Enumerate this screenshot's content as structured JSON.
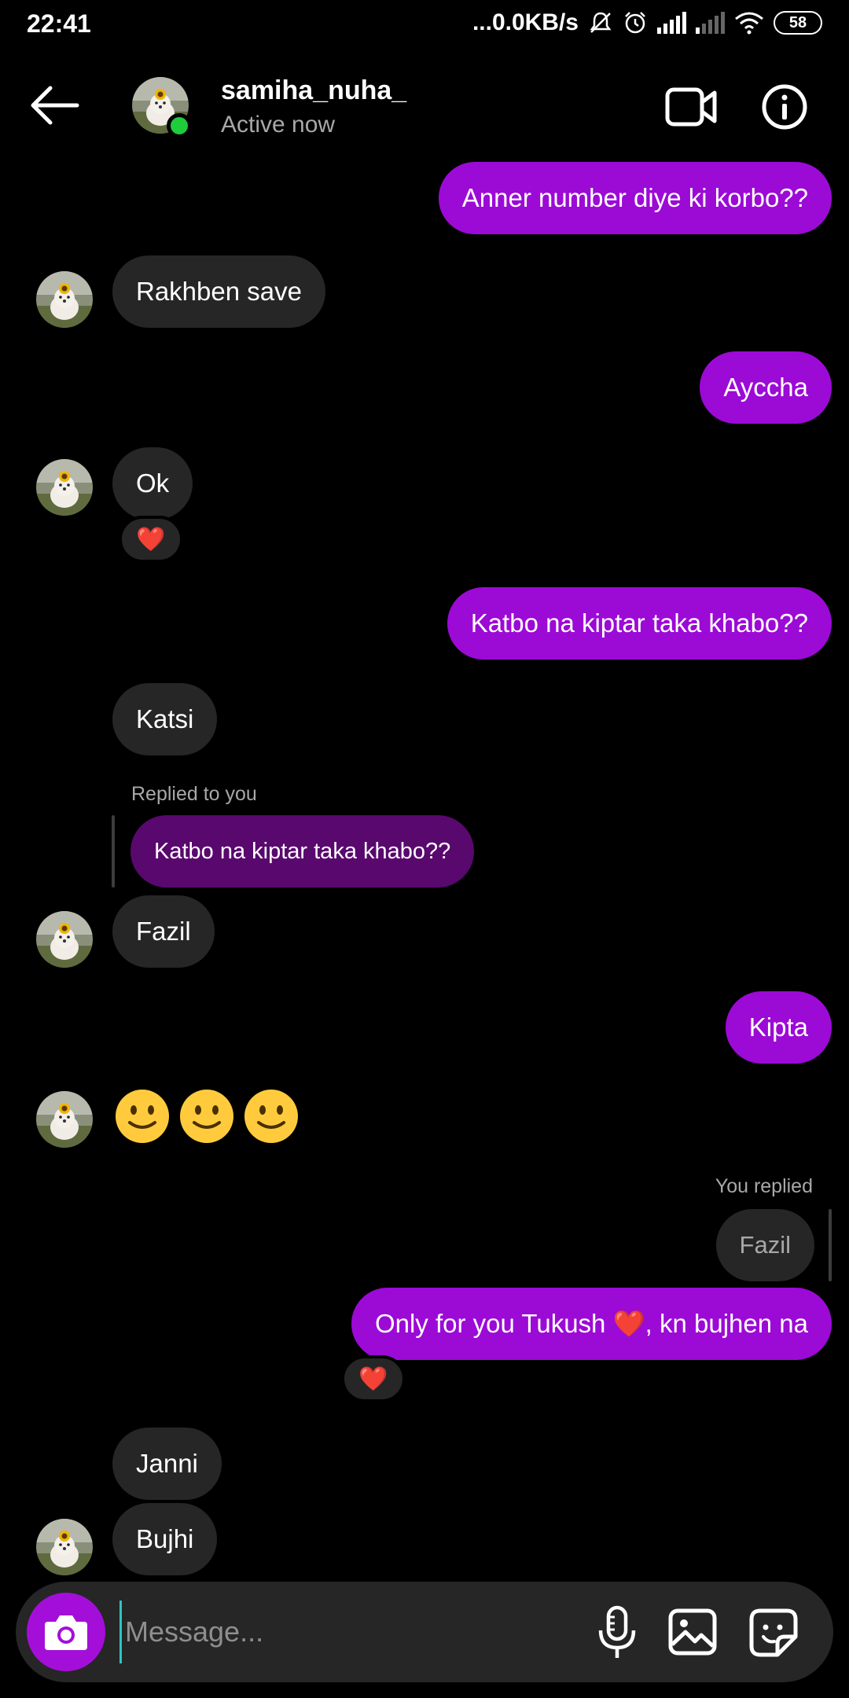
{
  "status_bar": {
    "time": "22:41",
    "network_speed": "...0.0KB/s",
    "battery": "58"
  },
  "header": {
    "contact_name": "samiha_nuha_",
    "contact_status": "Active now"
  },
  "messages": [
    {
      "text": "Anner number diye ki korbo??"
    },
    {
      "text": "Rakhben save"
    },
    {
      "text": "Ayccha"
    },
    {
      "text": "Ok",
      "reaction": "❤️"
    },
    {
      "text": "Katbo na kiptar taka khabo??"
    },
    {
      "text": "Katsi"
    },
    {
      "reply_label": "Replied to you",
      "quoted": "Katbo na kiptar taka khabo??",
      "text": "Fazil"
    },
    {
      "text": "Kipta"
    },
    {
      "text": "🙂🙂🙂"
    },
    {
      "reply_label": "You replied",
      "quoted": "Fazil",
      "text": "Only for you Tukush ❤️, kn bujhen na",
      "reaction": "❤️"
    },
    {
      "text": "Janni"
    },
    {
      "text": "Bujhi"
    }
  ],
  "composer": {
    "placeholder": "Message..."
  },
  "colors": {
    "outgoing_bubble": "#9c0ad6",
    "incoming_bubble": "#262626",
    "quoted_outgoing": "#59086e",
    "camera_button": "#a30fd8",
    "online_dot": "#1fcc3c"
  }
}
